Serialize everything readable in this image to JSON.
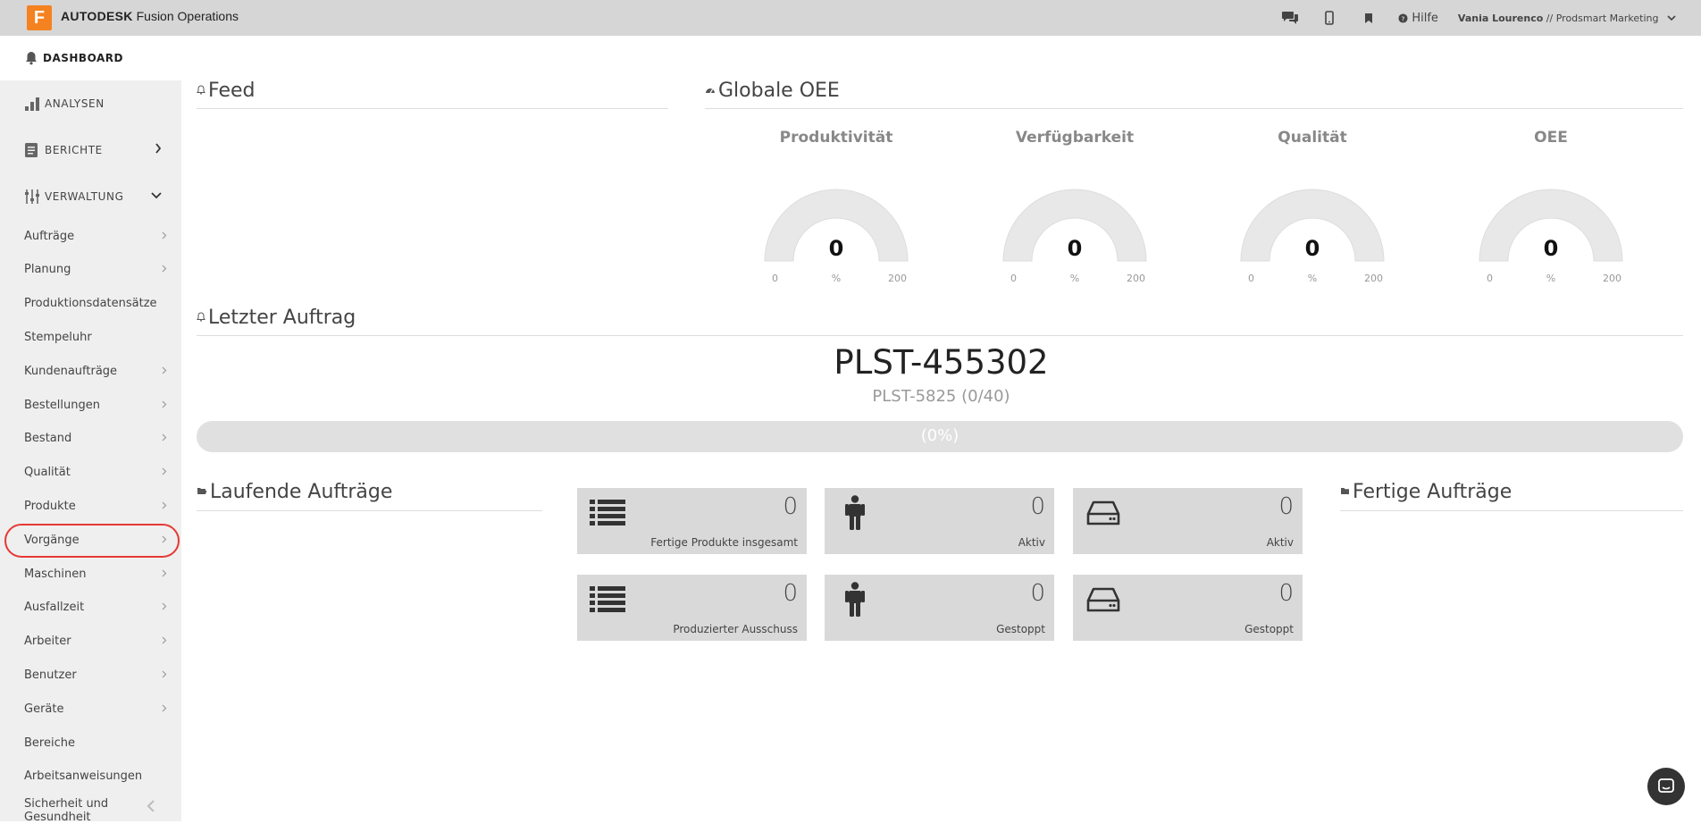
{
  "topbar": {
    "logo_letter": "F",
    "brand_bold": "AUTODESK",
    "brand_rest": " Fusion Operations",
    "help_label": "Hilfe",
    "user_name": "Vania Lourenco",
    "user_company": " // Prodsmart Marketing",
    "icons": [
      "chat-icon",
      "mobile-icon",
      "bookmark-icon",
      "help-icon",
      "chevron-down-icon"
    ]
  },
  "sidebar": {
    "dashboard": "DASHBOARD",
    "sections": [
      {
        "label": "ANALYSEN",
        "icon": "bar-chart-icon"
      },
      {
        "label": "BERICHTE",
        "icon": "document-icon"
      },
      {
        "label": "VERWALTUNG",
        "icon": "sliders-icon"
      }
    ],
    "items": [
      {
        "label": "Aufträge",
        "arrow": true
      },
      {
        "label": "Planung",
        "arrow": true
      },
      {
        "label": "Produktionsdatensätze",
        "arrow": false
      },
      {
        "label": "Stempeluhr",
        "arrow": false
      },
      {
        "label": "Kundenaufträge",
        "arrow": true
      },
      {
        "label": "Bestellungen",
        "arrow": true
      },
      {
        "label": "Bestand",
        "arrow": true
      },
      {
        "label": "Qualität",
        "arrow": true
      },
      {
        "label": "Produkte",
        "arrow": true
      },
      {
        "label": "Vorgänge",
        "arrow": true
      },
      {
        "label": "Maschinen",
        "arrow": true
      },
      {
        "label": "Ausfallzeit",
        "arrow": true
      },
      {
        "label": "Arbeiter",
        "arrow": true
      },
      {
        "label": "Benutzer",
        "arrow": true
      },
      {
        "label": "Geräte",
        "arrow": true
      },
      {
        "label": "Bereiche",
        "arrow": false
      },
      {
        "label": "Arbeitsanweisungen",
        "arrow": false
      },
      {
        "label": "Sicherheit und Gesundheit",
        "arrow": false
      }
    ]
  },
  "feed": {
    "title": "Feed"
  },
  "oee": {
    "title": "Globale OEE",
    "gauges": [
      {
        "title": "Produktivität",
        "value": "0",
        "min": "0",
        "unit": "%",
        "max": "200"
      },
      {
        "title": "Verfügbarkeit",
        "value": "0",
        "min": "0",
        "unit": "%",
        "max": "200"
      },
      {
        "title": "Qualität",
        "value": "0",
        "min": "0",
        "unit": "%",
        "max": "200"
      },
      {
        "title": "OEE",
        "value": "0",
        "min": "0",
        "unit": "%",
        "max": "200"
      }
    ]
  },
  "last_order": {
    "title": "Letzter Auftrag",
    "code": "PLST-455302",
    "sub": "PLST-5825 (0/40)",
    "progress_label": "(0%)",
    "progress_fraction": 0
  },
  "running": {
    "title": "Laufende Aufträge"
  },
  "finished": {
    "title": "Fertige Aufträge"
  },
  "tiles": [
    {
      "icon": "list-icon",
      "value": "0",
      "label": "Fertige Produkte insgesamt"
    },
    {
      "icon": "person-icon",
      "value": "0",
      "label": "Aktiv"
    },
    {
      "icon": "hard-drive-icon",
      "value": "0",
      "label": "Aktiv"
    },
    {
      "icon": "list-icon",
      "value": "0",
      "label": "Produzierter Ausschuss"
    },
    {
      "icon": "person-icon",
      "value": "0",
      "label": "Gestoppt"
    },
    {
      "icon": "hard-drive-icon",
      "value": "0",
      "label": "Gestoppt"
    }
  ]
}
